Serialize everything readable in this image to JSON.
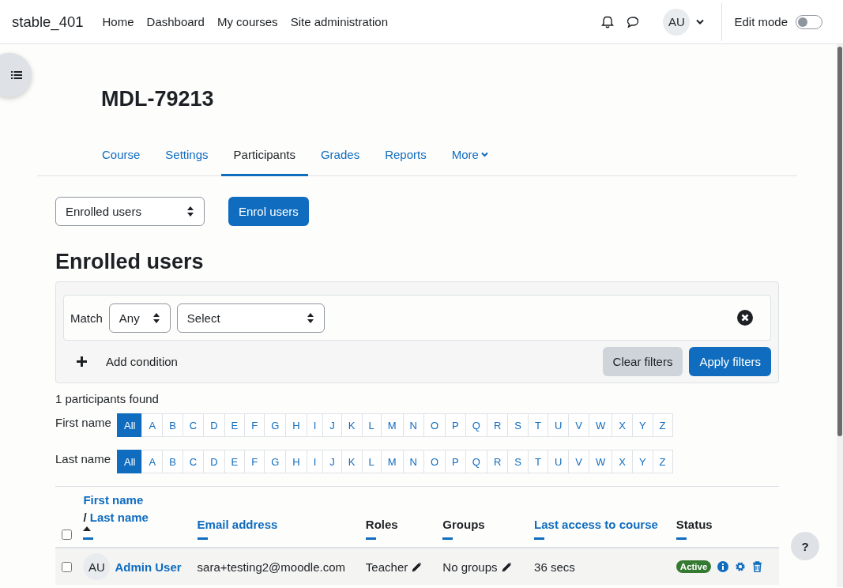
{
  "navbar": {
    "site_name": "stable_401",
    "links": [
      "Home",
      "Dashboard",
      "My courses",
      "Site administration"
    ],
    "avatar": "AU",
    "edit_mode": {
      "label": "Edit mode",
      "on": false
    }
  },
  "course": {
    "title": "MDL-79213",
    "tabs": [
      {
        "label": "Course",
        "selected": false,
        "has_menu": false
      },
      {
        "label": "Settings",
        "selected": false,
        "has_menu": false
      },
      {
        "label": "Participants",
        "selected": true,
        "has_menu": false
      },
      {
        "label": "Grades",
        "selected": false,
        "has_menu": false
      },
      {
        "label": "Reports",
        "selected": false,
        "has_menu": false
      },
      {
        "label": "More",
        "selected": false,
        "has_menu": true
      }
    ]
  },
  "toolbar": {
    "select_value": "Enrolled users",
    "button": "Enrol users"
  },
  "heading": "Enrolled users",
  "filter": {
    "match_label": "Match",
    "match_value": "Any",
    "field_value": "Select",
    "add_condition": "Add condition",
    "clear_button": "Clear filters",
    "apply_button": "Apply filters"
  },
  "count": "1 participants found",
  "initials_bars": [
    {
      "label": "First name",
      "letters": [
        {
          "label": "All",
          "selected": true
        },
        {
          "label": "A",
          "selected": false
        },
        {
          "label": "B",
          "selected": false
        },
        {
          "label": "C",
          "selected": false
        },
        {
          "label": "D",
          "selected": false
        },
        {
          "label": "E",
          "selected": false
        },
        {
          "label": "F",
          "selected": false
        },
        {
          "label": "G",
          "selected": false
        },
        {
          "label": "H",
          "selected": false
        },
        {
          "label": "I",
          "selected": false
        },
        {
          "label": "J",
          "selected": false
        },
        {
          "label": "K",
          "selected": false
        },
        {
          "label": "L",
          "selected": false
        },
        {
          "label": "M",
          "selected": false
        },
        {
          "label": "N",
          "selected": false
        },
        {
          "label": "O",
          "selected": false
        },
        {
          "label": "P",
          "selected": false
        },
        {
          "label": "Q",
          "selected": false
        },
        {
          "label": "R",
          "selected": false
        },
        {
          "label": "S",
          "selected": false
        },
        {
          "label": "T",
          "selected": false
        },
        {
          "label": "U",
          "selected": false
        },
        {
          "label": "V",
          "selected": false
        },
        {
          "label": "W",
          "selected": false
        },
        {
          "label": "X",
          "selected": false
        },
        {
          "label": "Y",
          "selected": false
        },
        {
          "label": "Z",
          "selected": false
        }
      ]
    },
    {
      "label": "Last name",
      "letters": [
        {
          "label": "All",
          "selected": true
        },
        {
          "label": "A",
          "selected": false
        },
        {
          "label": "B",
          "selected": false
        },
        {
          "label": "C",
          "selected": false
        },
        {
          "label": "D",
          "selected": false
        },
        {
          "label": "E",
          "selected": false
        },
        {
          "label": "F",
          "selected": false
        },
        {
          "label": "G",
          "selected": false
        },
        {
          "label": "H",
          "selected": false
        },
        {
          "label": "I",
          "selected": false
        },
        {
          "label": "J",
          "selected": false
        },
        {
          "label": "K",
          "selected": false
        },
        {
          "label": "L",
          "selected": false
        },
        {
          "label": "M",
          "selected": false
        },
        {
          "label": "N",
          "selected": false
        },
        {
          "label": "O",
          "selected": false
        },
        {
          "label": "P",
          "selected": false
        },
        {
          "label": "Q",
          "selected": false
        },
        {
          "label": "R",
          "selected": false
        },
        {
          "label": "S",
          "selected": false
        },
        {
          "label": "T",
          "selected": false
        },
        {
          "label": "U",
          "selected": false
        },
        {
          "label": "V",
          "selected": false
        },
        {
          "label": "W",
          "selected": false
        },
        {
          "label": "X",
          "selected": false
        },
        {
          "label": "Y",
          "selected": false
        },
        {
          "label": "Z",
          "selected": false
        }
      ]
    }
  ],
  "table": {
    "select_all_checked": false,
    "columns": [
      {
        "kind": "name",
        "links": [
          "First name",
          "Last name"
        ],
        "separator": "/",
        "sortable": true,
        "sorted": true
      },
      {
        "kind": "text",
        "label": "Email address",
        "sortable": true,
        "sorted": false
      },
      {
        "kind": "text",
        "label": "Roles",
        "sortable": false,
        "sorted": false
      },
      {
        "kind": "text",
        "label": "Groups",
        "sortable": false,
        "sorted": false
      },
      {
        "kind": "text",
        "label": "Last access to course",
        "sortable": true,
        "sorted": false
      },
      {
        "kind": "text",
        "label": "Status",
        "sortable": false,
        "sorted": false
      }
    ],
    "rows": [
      {
        "selected": false,
        "avatar": "AU",
        "name": "Admin User",
        "email": "sara+testing2@moodle.com",
        "roles": "Teacher",
        "groups": "No groups",
        "last_access": "36 secs",
        "status": "Active"
      }
    ]
  },
  "help_button": "?"
}
